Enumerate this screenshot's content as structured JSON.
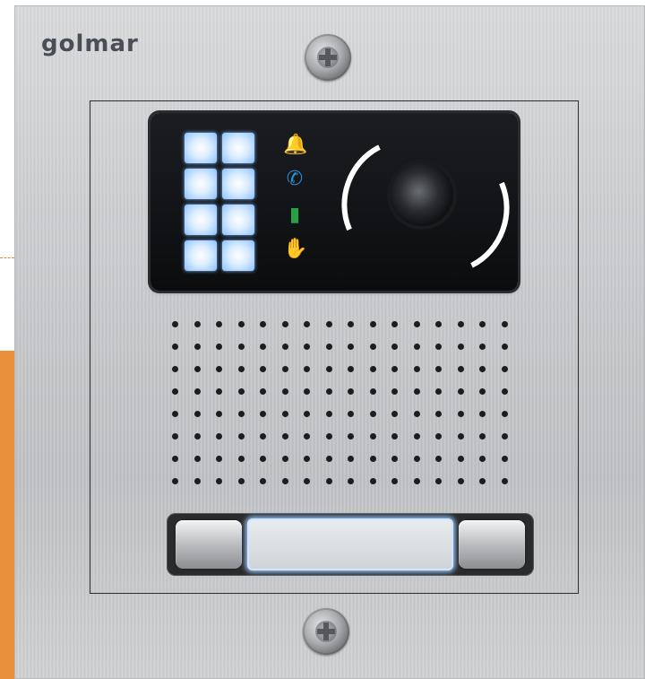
{
  "brand": {
    "logo_text": "golmar"
  },
  "icons": {
    "bell": "bell-icon",
    "phone": "phone-icon",
    "door": "door-icon",
    "hand": "hand-icon"
  },
  "colors": {
    "accent_orange": "#e8913a",
    "bell": "#e07a1f",
    "phone": "#2a8fd4",
    "door": "#2aa046",
    "hand": "#e03232",
    "key_glow": "#8cc2ff"
  },
  "display": {
    "keys_count": 8
  },
  "grille": {
    "rows": 8,
    "columns": 16
  }
}
